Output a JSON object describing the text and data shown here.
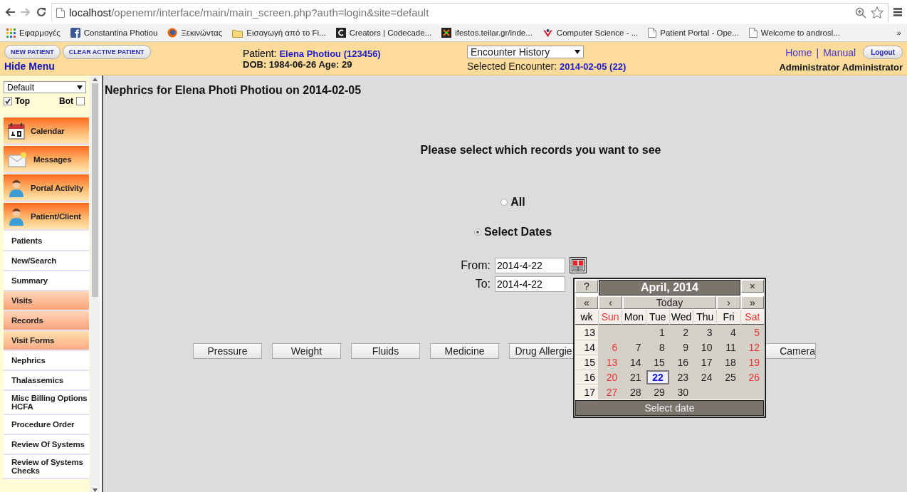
{
  "browser": {
    "url_host": "localhost",
    "url_path": "/openemr/interface/main/main_screen.php?auth=login&site=default",
    "bookmarks": [
      {
        "label": "Εφαρμογές"
      },
      {
        "label": "Constantina Photiou"
      },
      {
        "label": "Ξεκινώντας"
      },
      {
        "label": "Εισαγωγή από το Fi..."
      },
      {
        "label": "Creators | Codecade..."
      },
      {
        "label": "ifestos.teilar.gr/inde..."
      },
      {
        "label": "Computer Science - ..."
      },
      {
        "label": "Patient Portal - Ope..."
      },
      {
        "label": "Welcome to androsl..."
      }
    ],
    "overflow": "»"
  },
  "header": {
    "buttons": [
      "NEW PATIENT",
      "CLEAR ACTIVE PATIENT"
    ],
    "hide_menu": "Hide Menu",
    "patient_label": "Patient:",
    "patient_name": "Elena Photiou (123456)",
    "dob": "DOB: 1984-06-26 Age: 29",
    "encounter_select": "Encounter History",
    "selected_label": "Selected Encounter:",
    "selected_value": "2014-02-05 (22)",
    "links": [
      "Home",
      "Manual"
    ],
    "separator": "|",
    "logout": "Logout",
    "user": "Administrator Administrator"
  },
  "sidebar": {
    "select": "Default",
    "top": {
      "label": "Top",
      "checked": true
    },
    "bot": {
      "label": "Bot",
      "checked": false
    },
    "items": [
      {
        "kind": "calendar",
        "label": "Calendar"
      },
      {
        "kind": "envelope",
        "label": "Messages"
      },
      {
        "kind": "person",
        "label": "Portal Activity"
      },
      {
        "kind": "person",
        "label": "Patient/Client"
      },
      {
        "kind": "plain",
        "label": "Patients"
      },
      {
        "kind": "plain",
        "label": "New/Search"
      },
      {
        "kind": "plain",
        "label": "Summary"
      },
      {
        "kind": "section",
        "label": "Visits"
      },
      {
        "kind": "section",
        "label": "Records"
      },
      {
        "kind": "subsection",
        "label": "Visit Forms"
      },
      {
        "kind": "plain",
        "label": "Nephrics"
      },
      {
        "kind": "plain",
        "label": "Thalassemics"
      },
      {
        "kind": "plain",
        "label": "Misc Billing Options HCFA"
      },
      {
        "kind": "plain",
        "label": "Procedure Order"
      },
      {
        "kind": "plain",
        "label": "Review Of Systems"
      },
      {
        "kind": "plain",
        "label": "Review of Systems Checks"
      }
    ]
  },
  "main": {
    "title": "Nephrics for Elena Photi Photiou on 2014-02-05",
    "prompt": "Please select which records you want to see",
    "options": [
      {
        "label": "All",
        "selected": false
      },
      {
        "label": "Select Dates",
        "selected": true
      }
    ],
    "from": {
      "label": "From:",
      "value": "2014-4-22"
    },
    "to": {
      "label": "To:",
      "value": "2014-4-22"
    },
    "buttons": [
      "Pressure",
      "Weight",
      "Fluids",
      "Medicine",
      "Drug Allergie"
    ],
    "camera_button": "Camera"
  },
  "calendar": {
    "help": "?",
    "title": "April, 2014",
    "close": "×",
    "nav": [
      "«",
      "‹",
      "Today",
      "›",
      "»"
    ],
    "wk": "wk",
    "day_names": [
      {
        "label": "Sun",
        "weekend": true
      },
      {
        "label": "Mon",
        "weekend": false
      },
      {
        "label": "Tue",
        "weekend": false
      },
      {
        "label": "Wed",
        "weekend": false
      },
      {
        "label": "Thu",
        "weekend": false
      },
      {
        "label": "Fri",
        "weekend": false
      },
      {
        "label": "Sat",
        "weekend": true
      }
    ],
    "weeks": [
      {
        "wk": "13",
        "days": [
          {
            "d": "1",
            "selected": false
          },
          {
            "d": "2",
            "selected": false
          },
          {
            "d": "3",
            "selected": false
          },
          {
            "d": "4",
            "selected": false
          },
          {
            "d": "5",
            "selected": false
          }
        ]
      },
      {
        "wk": "14",
        "days": [
          {
            "d": "6",
            "selected": false
          },
          {
            "d": "7",
            "selected": false
          },
          {
            "d": "8",
            "selected": false
          },
          {
            "d": "9",
            "selected": false
          },
          {
            "d": "10",
            "selected": false
          },
          {
            "d": "11",
            "selected": false
          },
          {
            "d": "12",
            "selected": false
          }
        ]
      },
      {
        "wk": "15",
        "days": [
          {
            "d": "13",
            "selected": false
          },
          {
            "d": "14",
            "selected": false
          },
          {
            "d": "15",
            "selected": false
          },
          {
            "d": "16",
            "selected": false
          },
          {
            "d": "17",
            "selected": false
          },
          {
            "d": "18",
            "selected": false
          },
          {
            "d": "19",
            "selected": false
          }
        ]
      },
      {
        "wk": "16",
        "days": [
          {
            "d": "20",
            "selected": false
          },
          {
            "d": "21",
            "selected": false
          },
          {
            "d": "22",
            "selected": true
          },
          {
            "d": "23",
            "selected": false
          },
          {
            "d": "24",
            "selected": false
          },
          {
            "d": "25",
            "selected": false
          },
          {
            "d": "26",
            "selected": false
          }
        ]
      },
      {
        "wk": "17",
        "days": [
          {
            "d": "27",
            "selected": false
          },
          {
            "d": "28",
            "selected": false
          },
          {
            "d": "29",
            "selected": false
          },
          {
            "d": "30",
            "selected": false
          }
        ]
      }
    ],
    "footer": "Select date"
  }
}
